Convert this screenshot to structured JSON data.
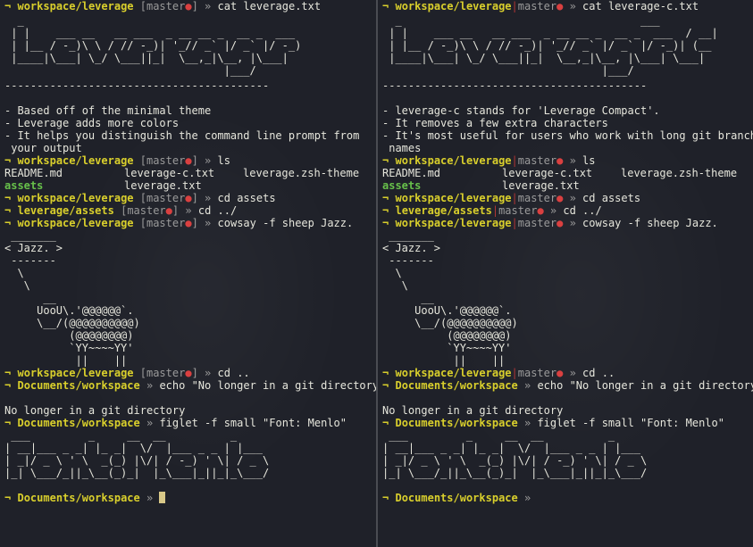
{
  "left": {
    "prompt": {
      "arrow": "¬",
      "dir": "workspace/leverage",
      "branch": "master",
      "dirty": "●",
      "sym": "»"
    },
    "cmd1": "cat leverage.txt",
    "banner": [
      "  _                                   ",
      " | |    ___ __   __ ___  _ __ __ _  __ _  ___ ",
      " | |__ / -_)\\ \\ / // -_)| '_// _` |/ _` |/ -_)",
      " |____|\\___| \\_/ \\___||_|  \\__,_|\\__, |\\___|",
      "                                  |___/      "
    ],
    "rule": "-----------------------------------------",
    "bullets": [
      "- Based off of the minimal theme",
      "- Leverage adds more colors",
      "- It helps you distinguish the command line prompt from",
      " your output"
    ],
    "cmd2": "ls",
    "ls_row1": [
      "README.md",
      "leverage-c.txt",
      "leverage.zsh-theme"
    ],
    "ls_row2": [
      "assets",
      "leverage.txt"
    ],
    "cmd3": "cd assets",
    "assets_dir": "leverage/assets",
    "cmd4": "cd ../",
    "cmd5": "cowsay -f sheep Jazz.",
    "cowsay": [
      " _______",
      "< Jazz. >",
      " -------",
      "  \\",
      "   \\",
      "      __",
      "     UooU\\.'@@@@@@`.",
      "     \\__/(@@@@@@@@@@)",
      "          (@@@@@@@@)",
      "          `YY~~~~YY'",
      "           ||    ||"
    ],
    "cmd6": "cd ..",
    "docs_dir": "Documents/workspace",
    "cmd7": "echo \"No longer in a git directory\"",
    "echo_out": "No longer in a git directory",
    "cmd8": "figlet -f small \"Font: Menlo\"",
    "figlet": [
      " ___         _     __  __          _       ",
      "| __|___ _ _| |_ _|  \\/  |___ _ _ | |___  ",
      "| _|/ _ \\ ' \\  _(_) |\\/| / -_) ' \\| / _ \\ ",
      "|_| \\___/_||_\\__(_)_|  |_\\___|_||_|_\\___/ "
    ]
  },
  "right": {
    "prompt": {
      "arrow": "¬",
      "dir": "workspace/leverage",
      "sep": "|",
      "branch": "master",
      "dirty": "●",
      "sym": "»"
    },
    "cmd1": "cat leverage-c.txt",
    "banner": [
      "  _                                     ___",
      " | |    ___ __   __ ___  _ __ __ _  __ _  ___  / __|",
      " | |__ / -_)\\ \\ / // -_)| '_// _` |/ _` |/ -_)| (__",
      " |____|\\___| \\_/ \\___||_|  \\__,_|\\__, |\\___| \\___|",
      "                                  |___/            "
    ],
    "rule": "-----------------------------------------",
    "bullets": [
      "- leverage-c stands for 'Leverage Compact'.",
      "- It removes a few extra characters",
      "- It's most useful for users who work with long git branch",
      " names"
    ],
    "cmd2": "ls",
    "ls_row1": [
      "README.md",
      "leverage-c.txt",
      "leverage.zsh-theme"
    ],
    "ls_row2": [
      "assets",
      "leverage.txt"
    ],
    "cmd3": "cd assets",
    "assets_dir": "leverage/assets",
    "cmd4": "cd ../",
    "cmd5": "cowsay -f sheep Jazz.",
    "cowsay": [
      " _______",
      "< Jazz. >",
      " -------",
      "  \\",
      "   \\",
      "      __",
      "     UooU\\.'@@@@@@`.",
      "     \\__/(@@@@@@@@@@)",
      "          (@@@@@@@@)",
      "          `YY~~~~YY'",
      "           ||    ||"
    ],
    "cmd6": "cd ..",
    "docs_dir": "Documents/workspace",
    "cmd7": "echo \"No longer in a git directory\"",
    "echo_out": "No longer in a git directory",
    "cmd8": "figlet -f small \"Font: Menlo\"",
    "figlet": [
      " ___         _     __  __          _       ",
      "| __|___ _ _| |_ _|  \\/  |___ _ _ | |___  ",
      "| _|/ _ \\ ' \\  _(_) |\\/| / -_) ' \\| / _ \\ ",
      "|_| \\___/_||_\\__(_)_|  |_\\___|_||_|_\\___/ "
    ]
  },
  "colors": {
    "background": "#1f2129",
    "prompt_path": "#d9cf2c",
    "branch_text": "#9a9a9a",
    "dirty_marker": "#d94040",
    "assets_dir": "#67c04a",
    "cursor": "#d8c888"
  }
}
